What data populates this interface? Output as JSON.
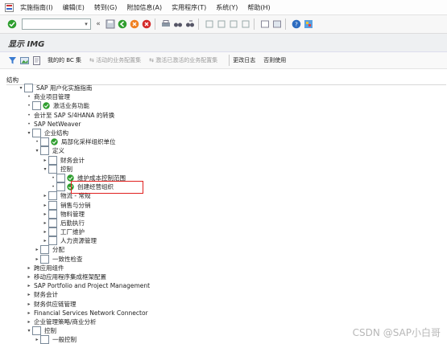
{
  "menu": [
    "实施指南(I)",
    "编辑(E)",
    "转到(G)",
    "附加信息(A)",
    "实用程序(T)",
    "系统(Y)",
    "帮助(H)"
  ],
  "title": "显示 IMG",
  "app_toolbar": {
    "bc_sets": "我的的 BC 集",
    "act_bc_sets": "活动的业务配置集",
    "act_bc_sets_2": "激活已激活的业务配置集",
    "change_log": "更改日志",
    "where_used": "否则使用"
  },
  "tree_header": "结构",
  "tree": [
    {
      "indent": 0,
      "exp": "open",
      "icon": "doc",
      "exec": false,
      "label": "SAP 用户化实施指南"
    },
    {
      "indent": 1,
      "exp": "dot",
      "icon": "none",
      "exec": false,
      "label": "商业项目管理"
    },
    {
      "indent": 1,
      "exp": "dot",
      "icon": "doc",
      "exec": true,
      "label": "激活业务功能"
    },
    {
      "indent": 1,
      "exp": "dot",
      "icon": "none",
      "exec": false,
      "label": "会计至 SAP S/4HANA 的转换"
    },
    {
      "indent": 1,
      "exp": "dot",
      "icon": "none",
      "exec": false,
      "label": "SAP NetWeaver"
    },
    {
      "indent": 1,
      "exp": "open",
      "icon": "doc",
      "exec": false,
      "label": "企业结构"
    },
    {
      "indent": 2,
      "exp": "dot",
      "icon": "doc",
      "exec": true,
      "label": "局部化采样组织单位"
    },
    {
      "indent": 2,
      "exp": "open",
      "icon": "doc",
      "exec": false,
      "label": "定义"
    },
    {
      "indent": 3,
      "exp": "closed",
      "icon": "doc",
      "exec": false,
      "label": "财务会计"
    },
    {
      "indent": 3,
      "exp": "open",
      "icon": "doc",
      "exec": false,
      "label": "控制"
    },
    {
      "indent": 4,
      "exp": "dot",
      "icon": "doc",
      "exec": true,
      "label": "维护成本控制范围"
    },
    {
      "indent": 4,
      "exp": "dot",
      "icon": "doc",
      "exec": true,
      "label": "创建经营组织"
    },
    {
      "indent": 3,
      "exp": "closed",
      "icon": "doc",
      "exec": false,
      "label": "物流 - 常规"
    },
    {
      "indent": 3,
      "exp": "closed",
      "icon": "doc",
      "exec": false,
      "label": "销售与分销"
    },
    {
      "indent": 3,
      "exp": "closed",
      "icon": "doc",
      "exec": false,
      "label": "物料管理"
    },
    {
      "indent": 3,
      "exp": "closed",
      "icon": "doc",
      "exec": false,
      "label": "后勤执行"
    },
    {
      "indent": 3,
      "exp": "closed",
      "icon": "doc",
      "exec": false,
      "label": "工厂维护"
    },
    {
      "indent": 3,
      "exp": "closed",
      "icon": "doc",
      "exec": false,
      "label": "人力资源管理"
    },
    {
      "indent": 2,
      "exp": "closed",
      "icon": "doc",
      "exec": false,
      "label": "分配"
    },
    {
      "indent": 2,
      "exp": "closed",
      "icon": "doc",
      "exec": false,
      "label": "一致性检查"
    },
    {
      "indent": 1,
      "exp": "closed",
      "icon": "none",
      "exec": false,
      "label": "跨应用组件"
    },
    {
      "indent": 1,
      "exp": "closed",
      "icon": "none",
      "exec": false,
      "label": "移动应用程序集成框架配置"
    },
    {
      "indent": 1,
      "exp": "closed",
      "icon": "none",
      "exec": false,
      "label": "SAP Portfolio and Project Management"
    },
    {
      "indent": 1,
      "exp": "closed",
      "icon": "none",
      "exec": false,
      "label": "财务会计"
    },
    {
      "indent": 1,
      "exp": "closed",
      "icon": "none",
      "exec": false,
      "label": "财务供应链管理"
    },
    {
      "indent": 1,
      "exp": "closed",
      "icon": "none",
      "exec": false,
      "label": "Financial Services Network Connector"
    },
    {
      "indent": 1,
      "exp": "closed",
      "icon": "none",
      "exec": false,
      "label": "企业管理策略/商业分析"
    },
    {
      "indent": 1,
      "exp": "open",
      "icon": "doc",
      "exec": false,
      "label": "控制"
    },
    {
      "indent": 2,
      "exp": "closed",
      "icon": "doc",
      "exec": false,
      "label": "一般控制"
    }
  ],
  "watermark": "CSDN @SAP小白哥",
  "colors": {
    "highlight": "#e0201e",
    "green": "#2f9e2f",
    "orange": "#f08020",
    "red": "#d42a2a"
  }
}
